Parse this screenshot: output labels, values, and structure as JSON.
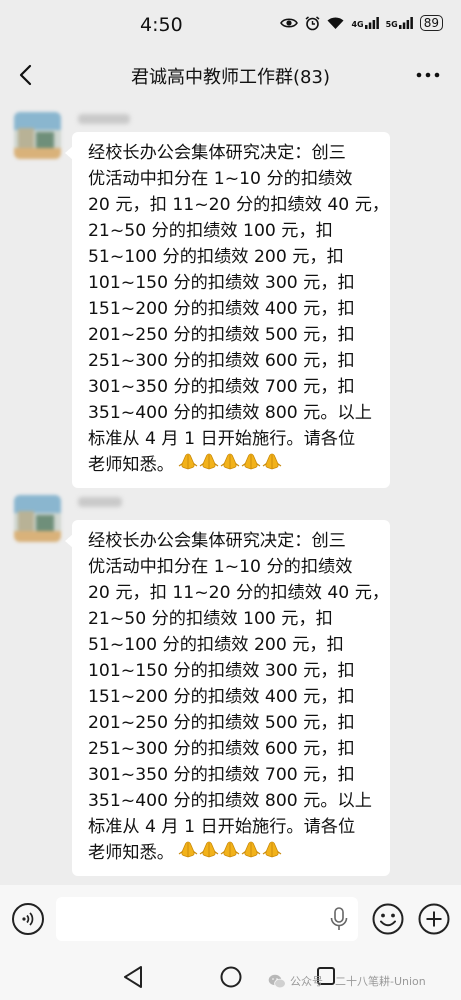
{
  "status_bar": {
    "time": "4:50",
    "network_1": "4G",
    "network_2": "5G",
    "battery": "89"
  },
  "header": {
    "title": "君诚高中教师工作群(83)"
  },
  "messages": [
    {
      "lines": [
        "经校长办公会集体研究决定：创三",
        "优活动中扣分在 1~10 分的扣绩效",
        "20 元，扣 11~20 分的扣绩效 40 元，",
        "21~50 分的扣绩效 100 元，扣",
        "51~100 分的扣绩效 200 元，扣",
        "101~150 分的扣绩效 300 元，扣",
        "151~200 分的扣绩效 400 元，扣",
        "201~250 分的扣绩效 500 元，扣",
        "251~300 分的扣绩效 600 元，扣",
        "301~350 分的扣绩效 700 元，扣",
        "351~400 分的扣绩效 800 元。以上",
        "标准从 4 月 1 日开始施行。请各位",
        "老师知悉。"
      ],
      "emoji_icon": "folded-hands-icon",
      "emoji_count": 5
    },
    {
      "lines": [
        "经校长办公会集体研究决定：创三",
        "优活动中扣分在 1~10 分的扣绩效",
        "20 元，扣 11~20 分的扣绩效 40 元，",
        "21~50 分的扣绩效 100 元，扣",
        "51~100 分的扣绩效 200 元，扣",
        "101~150 分的扣绩效 300 元，扣",
        "151~200 分的扣绩效 400 元，扣",
        "201~250 分的扣绩效 500 元，扣",
        "251~300 分的扣绩效 600 元，扣",
        "301~350 分的扣绩效 700 元，扣",
        "351~400 分的扣绩效 800 元。以上",
        "标准从 4 月 1 日开始施行。请各位",
        "老师知悉。"
      ],
      "emoji_icon": "folded-hands-icon",
      "emoji_count": 5
    }
  ],
  "input_bar": {
    "placeholder": ""
  },
  "watermark": {
    "label": "公众号",
    "account": "二十八笔耕-Union"
  },
  "colors": {
    "background": "#ededed",
    "bubble": "#ffffff",
    "emoji": "#f2b21a"
  }
}
